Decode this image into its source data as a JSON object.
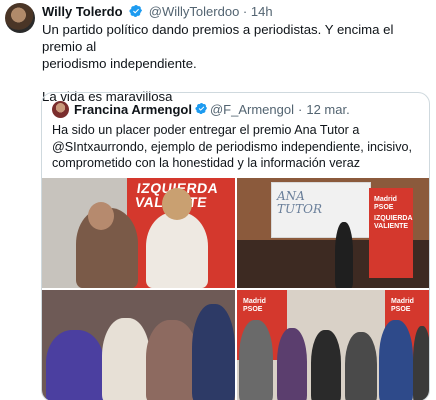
{
  "tweet": {
    "author_name": "Willy Tolerdo",
    "handle": "@WillyTolerdoo",
    "separator": "·",
    "time": "14h",
    "text_line1": "Un partido político dando premios a periodistas. Y encima el premio al",
    "text_line2": "periodismo independiente.",
    "text_line3": "La vida es maravillosa"
  },
  "quoted": {
    "author_name": "Francina Armengol",
    "handle": "@F_Armengol",
    "separator": "·",
    "time": "12 mar.",
    "text_line1": "Ha sido un placer poder entregar el premio Ana Tutor a",
    "text_line2": "@SIntxaurrondo, ejemplo de periodismo independiente, incisivo,",
    "text_line3": "comprometido con la honestidad y la información veraz"
  },
  "photos": {
    "p1_banner_line1": "IZQUIERDA",
    "p1_banner_line2": "VALIENTE",
    "p2_screen_line1": "ANA",
    "p2_screen_line2": "TUTOR",
    "p2_stand_line1": "Madrid",
    "p2_stand_line2": "PSOE",
    "p2_stand_line3": "IZQUIERDA",
    "p2_stand_line4": "VALIENTE",
    "p4_wall_left_line1": "Madrid",
    "p4_wall_left_line2": "PSOE",
    "p4_wall_right_line1": "Madrid",
    "p4_wall_right_line2": "PSOE"
  },
  "colors": {
    "verified": "#1d9bf0",
    "muted": "#536471",
    "brand_red": "#d4382d"
  }
}
